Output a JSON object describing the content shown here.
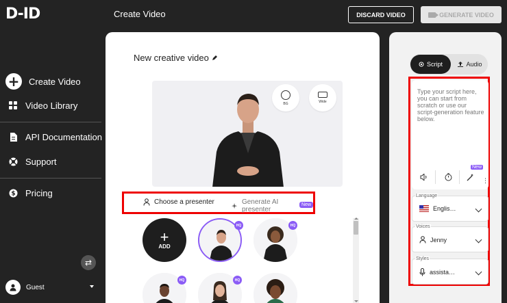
{
  "app": {
    "logo": "D-ID",
    "page_title": "Create Video"
  },
  "sidebar": {
    "items": [
      {
        "label": "Create Video",
        "icon": "plus-circle-icon"
      },
      {
        "label": "Video Library",
        "icon": "grid-icon"
      },
      {
        "label": "API Documentation",
        "icon": "document-icon"
      },
      {
        "label": "Support",
        "icon": "lifebuoy-icon"
      },
      {
        "label": "Pricing",
        "icon": "dollar-icon"
      }
    ],
    "user": {
      "name": "Guest"
    }
  },
  "header": {
    "discard_label": "DISCARD VIDEO",
    "generate_label": "GENERATE VIDEO"
  },
  "main": {
    "video_title": "New creative video",
    "preview_buttons": {
      "bg": "BG",
      "wide": "Wide"
    },
    "tabs": {
      "choose": "Choose a presenter",
      "generate": "Generate AI presenter",
      "new_badge": "New"
    },
    "add_label": "ADD",
    "hq_badge": "HQ"
  },
  "right_panel": {
    "tabs": {
      "script": "Script",
      "audio": "Audio"
    },
    "script_placeholder": "Type your script here, you can start from scratch or use our script-generation feature below.",
    "tool_new_badge": "New",
    "language": {
      "label": "Language",
      "value": "Englis…"
    },
    "voices": {
      "label": "Voices",
      "value": "Jenny"
    },
    "styles": {
      "label": "Styles",
      "value": "assista…"
    }
  },
  "colors": {
    "accent_purple": "#8b5cf6",
    "highlight_red": "#e00000",
    "sidebar_bg": "#232323"
  }
}
